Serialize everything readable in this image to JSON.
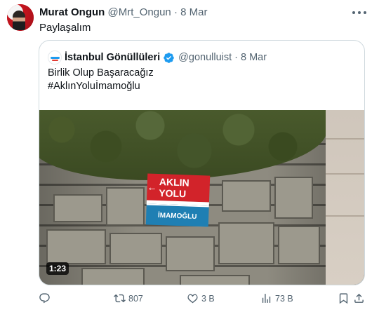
{
  "tweet": {
    "author_name": "Murat Ongun",
    "author_handle": "@Mrt_Ongun",
    "separator": "·",
    "date": "8 Mar",
    "text": "Paylaşalım"
  },
  "quoted": {
    "author_name": "İstanbul Gönüllüleri",
    "author_handle": "@gonulluist",
    "separator": "·",
    "date": "8 Mar",
    "text_line1": "Birlik Olup Başaracağız",
    "text_line2": "#AklınYoluİmamoğlu",
    "video": {
      "duration": "1:23",
      "sign_top": "AKLIN YOLU",
      "sign_arrow": "←",
      "sign_bottom": "İMAMOĞLU"
    }
  },
  "actions": {
    "reply_count": "",
    "retweet_count": "807",
    "like_count": "3 B",
    "views_count": "73 B"
  },
  "colors": {
    "verified": "#1d9bf0",
    "muted": "#536471",
    "border": "#cfd9de"
  },
  "icons": [
    "more-icon",
    "verified-icon",
    "reply-icon",
    "retweet-icon",
    "like-icon",
    "views-icon",
    "bookmark-icon",
    "share-icon"
  ]
}
